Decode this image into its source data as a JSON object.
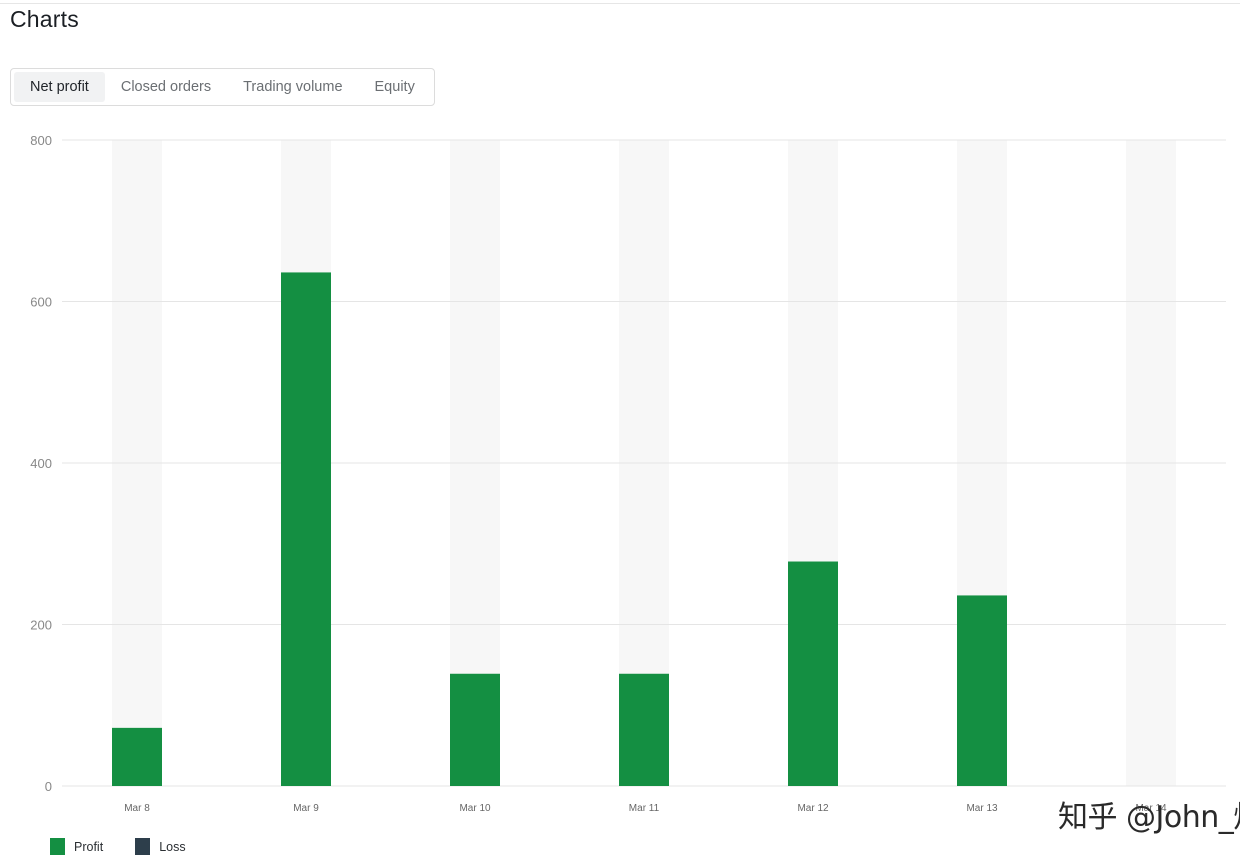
{
  "page": {
    "title": "Charts"
  },
  "tabs": [
    {
      "label": "Net profit",
      "active": true
    },
    {
      "label": "Closed orders",
      "active": false
    },
    {
      "label": "Trading volume",
      "active": false
    },
    {
      "label": "Equity",
      "active": false
    }
  ],
  "colors": {
    "profit": "#148f42",
    "loss": "#2d3e4b",
    "column_bg": "#f7f7f7",
    "grid": "#e5e5e5",
    "axis_text": "#888888"
  },
  "chart_data": {
    "type": "bar",
    "categories": [
      "Mar 8",
      "Mar 9",
      "Mar 10",
      "Mar 11",
      "Mar 12",
      "Mar 13",
      "Mar 14"
    ],
    "series": [
      {
        "name": "Profit",
        "values": [
          72,
          636,
          139,
          139,
          278,
          236,
          0
        ]
      },
      {
        "name": "Loss",
        "values": [
          0,
          0,
          0,
          0,
          0,
          0,
          0
        ]
      }
    ],
    "ylim": [
      0,
      800
    ],
    "yticks": [
      0,
      200,
      400,
      600,
      800
    ],
    "grid": true,
    "legend": "bottom-left"
  },
  "legend": {
    "items": [
      {
        "label": "Profit"
      },
      {
        "label": "Loss"
      }
    ]
  },
  "watermark": {
    "text": "知乎 @John_灿"
  }
}
